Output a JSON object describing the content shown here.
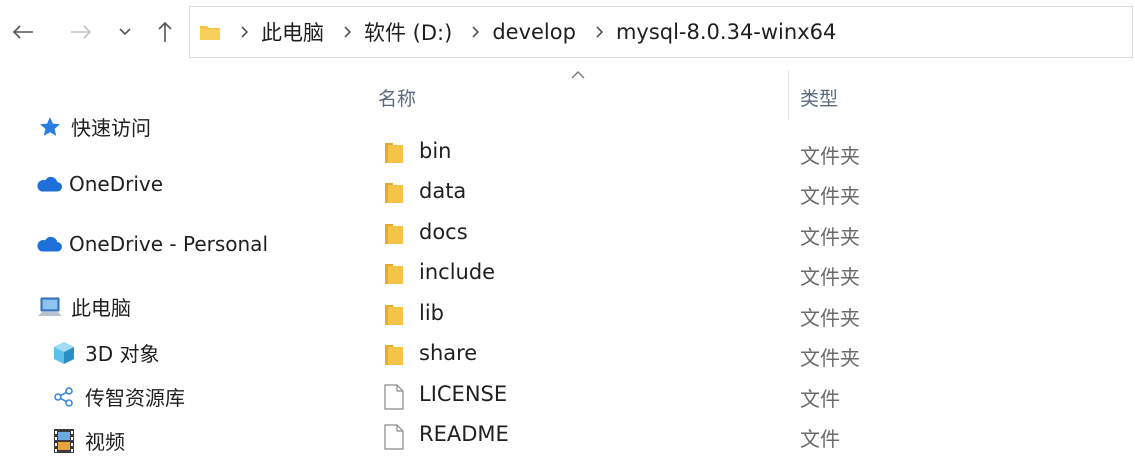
{
  "colors": {
    "folder": "#f5c24a",
    "folder_dark": "#e8a92b",
    "accent_blue": "#1e6fd9",
    "star": "#2a7de1"
  },
  "breadcrumb": [
    "此电脑",
    "软件 (D:)",
    "develop",
    "mysql-8.0.34-winx64"
  ],
  "sidebar": {
    "items": [
      {
        "label": "快速访问",
        "icon": "star-icon"
      },
      {
        "label": "OneDrive",
        "icon": "cloud-icon"
      },
      {
        "label": "OneDrive - Personal",
        "icon": "cloud-icon"
      },
      {
        "label": "此电脑",
        "icon": "computer-icon"
      },
      {
        "label": "3D 对象",
        "icon": "cube-3d-icon"
      },
      {
        "label": "传智资源库",
        "icon": "share-node-icon"
      },
      {
        "label": "视频",
        "icon": "video-film-icon"
      }
    ]
  },
  "columns": {
    "name": "名称",
    "type": "类型"
  },
  "files": [
    {
      "name": "bin",
      "type": "文件夹",
      "kind": "folder"
    },
    {
      "name": "data",
      "type": "文件夹",
      "kind": "folder"
    },
    {
      "name": "docs",
      "type": "文件夹",
      "kind": "folder"
    },
    {
      "name": "include",
      "type": "文件夹",
      "kind": "folder"
    },
    {
      "name": "lib",
      "type": "文件夹",
      "kind": "folder"
    },
    {
      "name": "share",
      "type": "文件夹",
      "kind": "folder"
    },
    {
      "name": "LICENSE",
      "type": "文件",
      "kind": "file"
    },
    {
      "name": "README",
      "type": "文件",
      "kind": "file"
    }
  ]
}
